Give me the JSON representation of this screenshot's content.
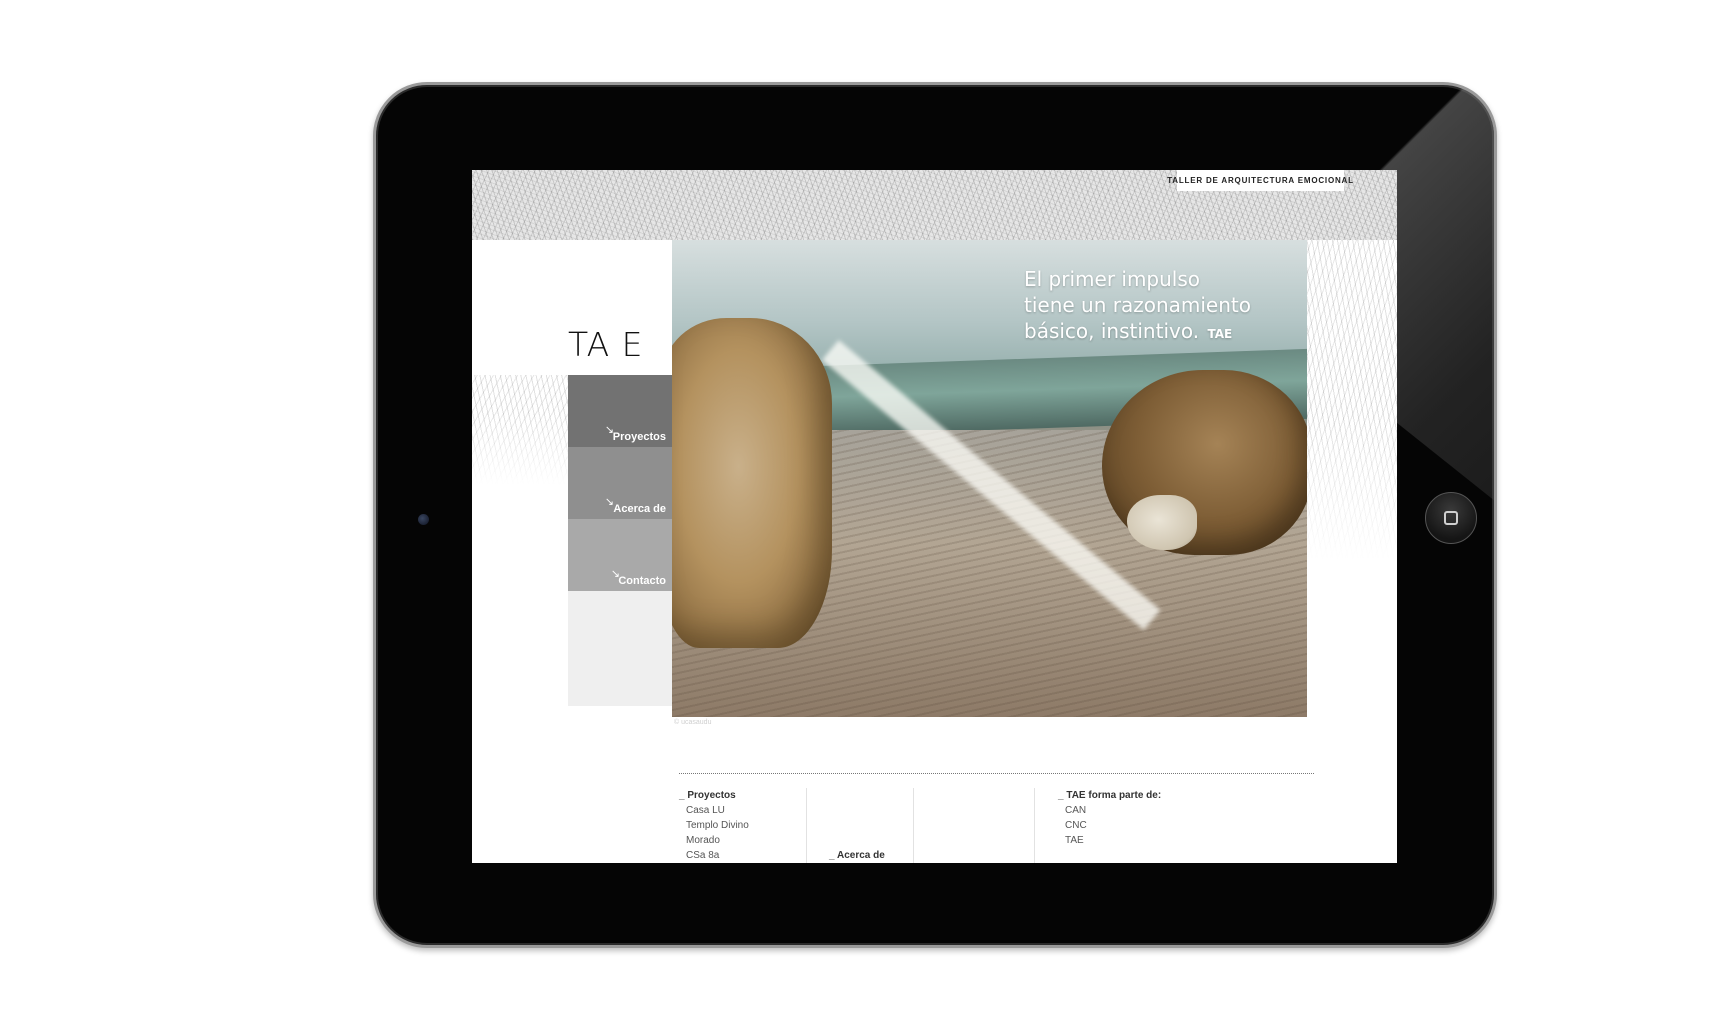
{
  "site": {
    "tagline_badge": "TALLER DE ARQUITECTURA EMOCIONAL",
    "logo_text": "TA E"
  },
  "nav": {
    "items": [
      {
        "label": "Proyectos",
        "icon": "arrow-down-right-icon",
        "color": "#727272"
      },
      {
        "label": "Acerca de",
        "icon": "arrow-down-right-icon",
        "color": "#8f8f8f"
      },
      {
        "label": "Contacto",
        "icon": "arrow-down-right-icon",
        "color": "#a9a9a9"
      }
    ]
  },
  "hero": {
    "quote_line1": "El primer impulso",
    "quote_line2": "tiene un razonamiento",
    "quote_line3": "básico, instintivo.",
    "quote_tag": "TAE",
    "caption": "© ucasaudu"
  },
  "footer": {
    "projects": {
      "heading": "_ Proyectos",
      "links": [
        "Casa LU",
        "Templo Divino",
        "Morado",
        "CSa 8a"
      ]
    },
    "about": {
      "heading": "_ Acerca de"
    },
    "network": {
      "heading": "_ TAE forma parte de:",
      "links": [
        "CAN",
        "CNC",
        "TAE"
      ]
    }
  },
  "device": {
    "home_button_icon": "home-square-icon",
    "camera_icon": "front-camera-icon"
  }
}
